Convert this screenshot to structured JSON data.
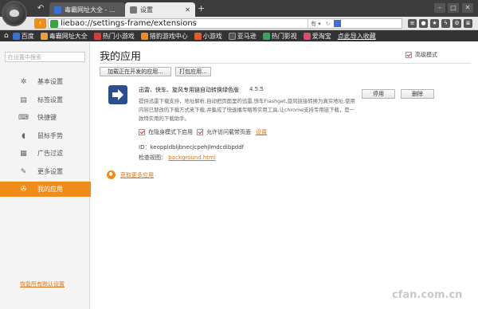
{
  "tabs": [
    {
      "label": "毒霸网址大全 - ..."
    },
    {
      "label": "设置"
    }
  ],
  "new_tab": "+",
  "address": {
    "url": "liebao://settings-frame/extensions",
    "search_engine": "有 ▾"
  },
  "bookmarks": [
    {
      "label": "百度",
      "color": "#3b6fd8"
    },
    {
      "label": "毒霸网址大全",
      "color": "#e8a23a"
    },
    {
      "label": "热门小游戏",
      "color": "#d33f3f"
    },
    {
      "label": "猎豹游戏中心",
      "color": "#f08c1a"
    },
    {
      "label": "小游戏",
      "color": "#e55a2b"
    },
    {
      "label": "亚马逊",
      "color": "#555555"
    },
    {
      "label": "热门影视",
      "color": "#3aa55a"
    },
    {
      "label": "爱淘宝",
      "color": "#e04b6b"
    },
    {
      "label": "点此导入收藏",
      "color": ""
    }
  ],
  "sidebar": {
    "search_placeholder": "在设置中搜索",
    "items": [
      {
        "label": "基本设置",
        "icon": "gear-icon",
        "glyph": "✲"
      },
      {
        "label": "标签设置",
        "icon": "tabs-icon",
        "glyph": "▤"
      },
      {
        "label": "快捷键",
        "icon": "keyboard-icon",
        "glyph": "⌨"
      },
      {
        "label": "鼠标手势",
        "icon": "mouse-icon",
        "glyph": "◖"
      },
      {
        "label": "广告过滤",
        "icon": "filter-icon",
        "glyph": "▦"
      },
      {
        "label": "更多设置",
        "icon": "wrench-icon",
        "glyph": "✎"
      },
      {
        "label": "我的应用",
        "icon": "apps-icon",
        "glyph": "✇"
      }
    ],
    "active_index": 6,
    "reset_label": "恢复所有默认设置"
  },
  "main": {
    "title": "我的应用",
    "dev_mode_label": "高级模式",
    "dev_mode_checked": true,
    "load_unpacked_label": "加载正在开发的应用...",
    "pack_label": "打包应用...",
    "extension": {
      "name": "迅雷、快车、旋风专用链自动转换绿色版",
      "version": "4.5.5",
      "description": "提供迅雷下载支持，地址解析,自动把页面里的迅雷,快车Flashget,旋风链接转换为真实地址,使用内容已替改的下载方式来下载,并集成了快速播专略等实用工具,让chrome支持专用链下载，是一款特实用的下载助手。",
      "disable_label": "停用",
      "remove_label": "删除",
      "incognito_label": "在隐身模式下启用",
      "incognito_checked": true,
      "file_access_label": "允许访问载带页面",
      "file_access_checked": true,
      "options_label": "设置",
      "id_label": "ID：",
      "id_value": "keoppldbljbnecjcpehjlmdcdibpddf",
      "inspect_label": "检查视图：",
      "inspect_link": "background.html"
    },
    "get_more_label": "获取更多应用"
  },
  "watermark": "cfan.com.cn",
  "colors": {
    "accent": "#f08c1a",
    "link": "#d8761c",
    "toolbar": "#333333"
  }
}
